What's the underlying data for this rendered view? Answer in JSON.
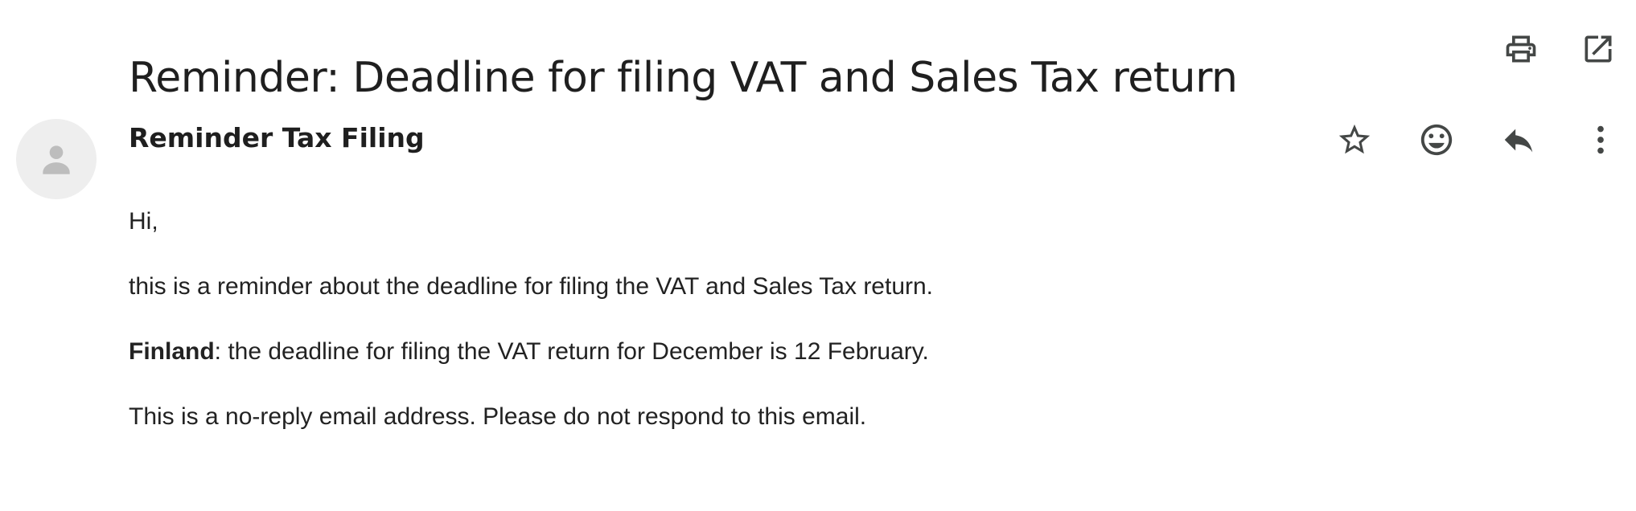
{
  "email": {
    "subject": "Reminder: Deadline for filing VAT and Sales Tax return",
    "sender_name": "Reminder Tax Filing",
    "body": {
      "greeting": "Hi,",
      "paragraph_1": "this is a reminder about the deadline for filing the VAT and Sales Tax return.",
      "paragraph_2_bold": "Finland",
      "paragraph_2_rest": ": the deadline for filing the VAT return for December is 12 February.",
      "paragraph_3": "This is a no-reply email address. Please do not respond to this email."
    }
  },
  "header_actions": [
    {
      "name": "print-all",
      "icon": "print-icon"
    },
    {
      "name": "open-new-window",
      "icon": "open-in-new-icon"
    }
  ],
  "message_actions": [
    {
      "name": "star",
      "icon": "star-icon"
    },
    {
      "name": "add-reaction",
      "icon": "emoji-icon"
    },
    {
      "name": "reply",
      "icon": "reply-icon"
    },
    {
      "name": "more",
      "icon": "more-vert-icon"
    }
  ],
  "colors": {
    "text": "#1f1f1f",
    "icon": "#444746",
    "avatar_bg": "#eeeeee",
    "avatar_fg": "#bdbdbd"
  }
}
